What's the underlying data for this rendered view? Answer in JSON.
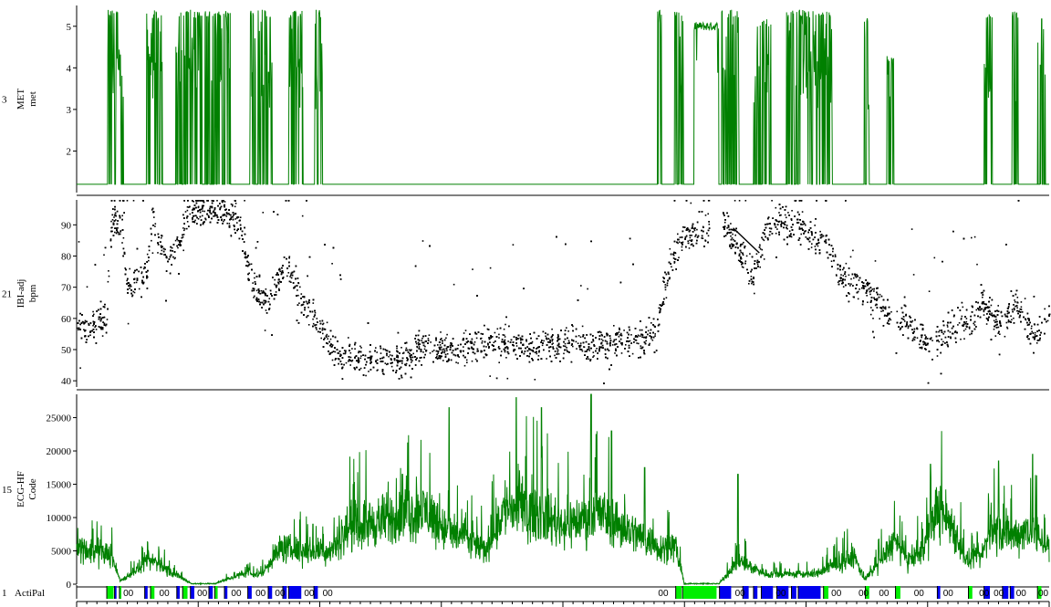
{
  "chart_data": [
    {
      "type": "line",
      "channel_number": "3",
      "ylabel": "MET",
      "unit": "met",
      "ylim": [
        1.0,
        5.5
      ],
      "yticks": [
        "2",
        "3",
        "4",
        "5"
      ],
      "color": "#008000",
      "baseline_value": 1.2,
      "series": [
        {
          "x_start": 0,
          "x_end": 100,
          "bursts": [
            {
              "from": 3.2,
              "to": 4.8,
              "max": 5.4
            },
            {
              "from": 7.2,
              "to": 8.8,
              "max": 5.4
            },
            {
              "from": 10.2,
              "to": 12.9,
              "max": 5.4
            },
            {
              "from": 13.2,
              "to": 15.8,
              "max": 5.4
            },
            {
              "from": 17.8,
              "to": 20.1,
              "max": 5.4
            },
            {
              "from": 21.8,
              "to": 23.3,
              "max": 5.4
            },
            {
              "from": 24.5,
              "to": 25.3,
              "max": 5.4
            },
            {
              "from": 59.7,
              "to": 60.2,
              "max": 5.4
            },
            {
              "from": 61.5,
              "to": 62.4,
              "max": 5.4
            },
            {
              "from": 66.3,
              "to": 68.1,
              "max": 5.4
            },
            {
              "from": 69.6,
              "to": 71.4,
              "max": 5.2
            },
            {
              "from": 73.0,
              "to": 77.7,
              "max": 5.4
            },
            {
              "from": 81.0,
              "to": 81.5,
              "max": 5.2
            },
            {
              "from": 83.3,
              "to": 84.0,
              "max": 4.3
            },
            {
              "from": 93.3,
              "to": 94.2,
              "max": 5.4
            },
            {
              "from": 96.2,
              "to": 96.8,
              "max": 5.4
            },
            {
              "from": 98.8,
              "to": 99.6,
              "max": 5.3
            }
          ],
          "plateau": {
            "from": 63.5,
            "to": 66.0,
            "value": 5.0
          }
        }
      ]
    },
    {
      "type": "scatter",
      "channel_number": "21",
      "ylabel": "IBI-adj",
      "unit": "bpm",
      "ylim": [
        38,
        98
      ],
      "yticks": [
        "40",
        "50",
        "60",
        "70",
        "80",
        "90"
      ],
      "color": "#000000",
      "gap": [
        65.0,
        66.4
      ],
      "level_profile": [
        [
          0,
          57
        ],
        [
          3,
          60
        ],
        [
          3.6,
          92
        ],
        [
          4.5,
          90
        ],
        [
          5.2,
          70
        ],
        [
          7.2,
          75
        ],
        [
          7.8,
          93
        ],
        [
          9.0,
          78
        ],
        [
          10.5,
          84
        ],
        [
          11.5,
          93
        ],
        [
          13.3,
          95
        ],
        [
          16.5,
          92
        ],
        [
          18.0,
          72
        ],
        [
          19.5,
          65
        ],
        [
          21.5,
          78
        ],
        [
          23.0,
          68
        ],
        [
          24.0,
          62
        ],
        [
          25.5,
          55
        ],
        [
          26.5,
          48
        ],
        [
          34,
          47
        ],
        [
          35,
          52
        ],
        [
          38,
          50
        ],
        [
          42,
          52
        ],
        [
          48,
          52
        ],
        [
          54,
          52
        ],
        [
          58,
          53
        ],
        [
          59.5,
          55
        ],
        [
          60.5,
          72
        ],
        [
          61.5,
          82
        ],
        [
          62.0,
          85
        ],
        [
          66.4,
          92
        ],
        [
          68.0,
          82
        ],
        [
          69.5,
          75
        ],
        [
          71.0,
          90
        ],
        [
          74.0,
          90
        ],
        [
          77.0,
          84
        ],
        [
          79.0,
          72
        ],
        [
          81.0,
          70
        ],
        [
          83.0,
          62
        ],
        [
          85.0,
          60
        ],
        [
          86.0,
          56
        ],
        [
          88.0,
          52
        ],
        [
          90.0,
          57
        ],
        [
          92.0,
          60
        ],
        [
          93.0,
          66
        ],
        [
          95.0,
          58
        ],
        [
          96.5,
          65
        ],
        [
          98.5,
          55
        ],
        [
          100,
          62
        ]
      ]
    },
    {
      "type": "line",
      "channel_number": "15",
      "ylabel": "ECG-HF",
      "unit": "Code",
      "ylim": [
        0,
        28500
      ],
      "yticks": [
        "0",
        "5000",
        "10000",
        "15000",
        "20000",
        "25000"
      ],
      "color": "#008000",
      "level_profile": [
        [
          0,
          5500
        ],
        [
          3.5,
          4500
        ],
        [
          4.5,
          500
        ],
        [
          7,
          3000
        ],
        [
          8,
          3500
        ],
        [
          10,
          1500
        ],
        [
          12,
          0
        ],
        [
          14,
          0
        ],
        [
          17,
          1500
        ],
        [
          19,
          1500
        ],
        [
          21,
          5500
        ],
        [
          23,
          5000
        ],
        [
          26,
          5000
        ],
        [
          28,
          8500
        ],
        [
          33,
          10000
        ],
        [
          36,
          11000
        ],
        [
          38,
          8000
        ],
        [
          40,
          7000
        ],
        [
          42,
          5000
        ],
        [
          44,
          11500
        ],
        [
          47,
          11000
        ],
        [
          50,
          9000
        ],
        [
          54,
          10500
        ],
        [
          57,
          8000
        ],
        [
          60,
          5500
        ],
        [
          61.5,
          6000
        ],
        [
          62.5,
          0
        ],
        [
          66,
          0
        ],
        [
          68,
          3500
        ],
        [
          71,
          1500
        ],
        [
          76,
          1500
        ],
        [
          78,
          3000
        ],
        [
          80,
          4000
        ],
        [
          81,
          800
        ],
        [
          82,
          2000
        ],
        [
          84,
          6500
        ],
        [
          85.5,
          3500
        ],
        [
          87,
          5000
        ],
        [
          88.5,
          11500
        ],
        [
          90,
          9000
        ],
        [
          91.5,
          3500
        ],
        [
          93,
          4000
        ],
        [
          94,
          8500
        ],
        [
          96,
          7000
        ],
        [
          98,
          8500
        ],
        [
          100,
          5500
        ]
      ],
      "peaks": [
        {
          "x": 24.3,
          "y": 9000
        },
        {
          "x": 33.5,
          "y": 16500
        },
        {
          "x": 38.3,
          "y": 26500
        },
        {
          "x": 45.2,
          "y": 28000
        },
        {
          "x": 47.8,
          "y": 26500
        },
        {
          "x": 52.9,
          "y": 28500
        },
        {
          "x": 55.0,
          "y": 23000
        },
        {
          "x": 58.4,
          "y": 17500
        },
        {
          "x": 68.0,
          "y": 16500
        },
        {
          "x": 87.8,
          "y": 18000
        },
        {
          "x": 94.8,
          "y": 18500
        },
        {
          "x": 98.3,
          "y": 19500
        }
      ]
    },
    {
      "type": "heatmap",
      "channel_number": "1",
      "ylabel": "ActiPal",
      "colors": {
        "stand": "#00ee00",
        "walk": "#0000ee",
        "sit": "#000000",
        "code_text": "#000000"
      },
      "code_label": "00",
      "segments": [
        {
          "from": 3.1,
          "to": 3.8,
          "state": "stand"
        },
        {
          "from": 3.9,
          "to": 4.1,
          "state": "walk"
        },
        {
          "from": 4.4,
          "to": 4.6,
          "state": "stand"
        },
        {
          "from": 7.0,
          "to": 7.3,
          "state": "walk"
        },
        {
          "from": 7.6,
          "to": 8.0,
          "state": "stand"
        },
        {
          "from": 10.3,
          "to": 10.6,
          "state": "walk"
        },
        {
          "from": 10.9,
          "to": 11.4,
          "state": "stand"
        },
        {
          "from": 11.7,
          "to": 12.1,
          "state": "walk"
        },
        {
          "from": 13.6,
          "to": 14.0,
          "state": "walk"
        },
        {
          "from": 14.2,
          "to": 14.5,
          "state": "stand"
        },
        {
          "from": 15.2,
          "to": 15.5,
          "state": "walk"
        },
        {
          "from": 17.6,
          "to": 18.0,
          "state": "walk"
        },
        {
          "from": 19.7,
          "to": 20.1,
          "state": "walk"
        },
        {
          "from": 21.2,
          "to": 21.6,
          "state": "walk"
        },
        {
          "from": 21.8,
          "to": 23.1,
          "state": "walk"
        },
        {
          "from": 24.4,
          "to": 24.8,
          "state": "walk"
        },
        {
          "from": 61.6,
          "to": 62.2,
          "state": "stand"
        },
        {
          "from": 62.3,
          "to": 65.8,
          "state": "stand"
        },
        {
          "from": 66.1,
          "to": 67.3,
          "state": "walk"
        },
        {
          "from": 68.5,
          "to": 69.1,
          "state": "walk"
        },
        {
          "from": 69.6,
          "to": 70.0,
          "state": "walk"
        },
        {
          "from": 70.4,
          "to": 71.6,
          "state": "walk"
        },
        {
          "from": 72.0,
          "to": 73.2,
          "state": "walk"
        },
        {
          "from": 73.5,
          "to": 74.0,
          "state": "walk"
        },
        {
          "from": 74.2,
          "to": 76.5,
          "state": "walk"
        },
        {
          "from": 76.8,
          "to": 77.3,
          "state": "stand"
        },
        {
          "from": 81.1,
          "to": 81.5,
          "state": "stand"
        },
        {
          "from": 84.2,
          "to": 84.7,
          "state": "stand"
        },
        {
          "from": 88.5,
          "to": 88.8,
          "state": "walk"
        },
        {
          "from": 91.7,
          "to": 92.1,
          "state": "stand"
        },
        {
          "from": 93.3,
          "to": 93.9,
          "state": "walk"
        },
        {
          "from": 95.2,
          "to": 95.8,
          "state": "walk"
        },
        {
          "from": 96.0,
          "to": 96.4,
          "state": "walk"
        },
        {
          "from": 98.8,
          "to": 99.2,
          "state": "stand"
        }
      ],
      "code_positions": [
        4.7,
        8.4,
        12.3,
        15.8,
        18.3,
        20.3,
        23.3,
        25.2,
        59.7,
        67.6,
        71.8,
        77.5,
        80.3,
        82.4,
        86.0,
        89.0,
        92.7,
        94.2,
        96.5,
        100.0
      ]
    }
  ]
}
